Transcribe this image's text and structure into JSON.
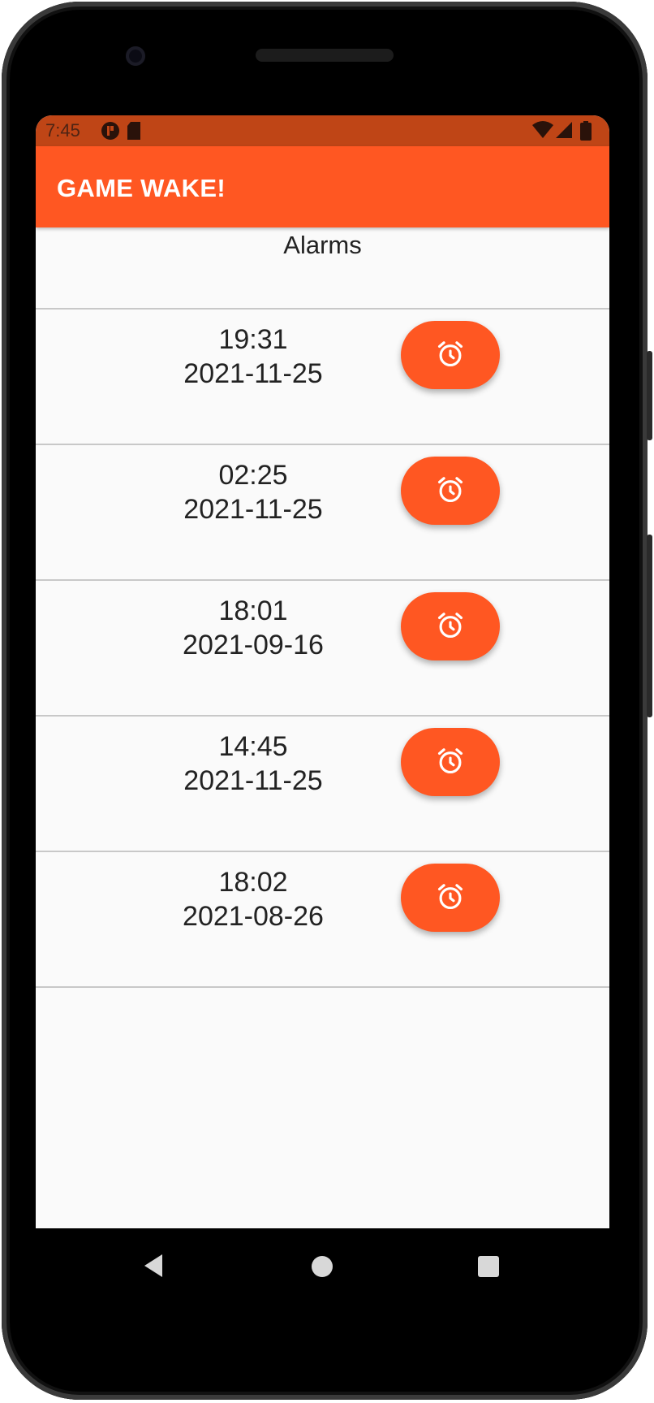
{
  "status_bar": {
    "time": "7:45"
  },
  "app_bar": {
    "title": "GAME WAKE!",
    "color": "#ff5722"
  },
  "section": {
    "title": "Alarms"
  },
  "alarms": [
    {
      "time": "19:31",
      "date": "2021-11-25",
      "icon": "alarm-clock-icon"
    },
    {
      "time": "02:25",
      "date": "2021-11-25",
      "icon": "alarm-clock-icon"
    },
    {
      "time": "18:01",
      "date": "2021-09-16",
      "icon": "alarm-clock-icon"
    },
    {
      "time": "14:45",
      "date": "2021-11-25",
      "icon": "alarm-clock-icon"
    },
    {
      "time": "18:02",
      "date": "2021-08-26",
      "icon": "alarm-clock-icon"
    }
  ],
  "nav": {
    "back_icon": "back-triangle-icon",
    "home_icon": "home-circle-icon",
    "recents_icon": "recents-square-icon"
  }
}
